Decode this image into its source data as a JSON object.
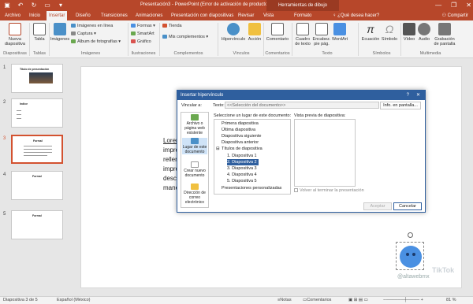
{
  "window": {
    "title": "Presentación3 - PowerPoint (Error de activación de productos)",
    "context_tab": "Herramientas de dibujo",
    "controls": [
      "—",
      "❐",
      "✕"
    ]
  },
  "tabs": [
    {
      "label": "Archivo"
    },
    {
      "label": "Inicio"
    },
    {
      "label": "Insertar"
    },
    {
      "label": "Diseño"
    },
    {
      "label": "Transiciones"
    },
    {
      "label": "Animaciones"
    },
    {
      "label": "Presentación con diapositivas"
    },
    {
      "label": "Revisar"
    },
    {
      "label": "Vista"
    },
    {
      "label": "Formato"
    }
  ],
  "tell_me": "¿Qué desea hacer?",
  "share": "Compartir",
  "ribbon": {
    "nueva": "Nueva diapositiva",
    "tabla": "Tabla",
    "imagenes": "Imágenes",
    "imagenes_linea": "Imágenes en línea",
    "captura": "Captura",
    "album": "Álbum de fotografías",
    "formas": "Formas",
    "smartart": "SmartArt",
    "grafico": "Gráfico",
    "tienda": "Tienda",
    "complementos": "Mis complementos",
    "hipervinculo": "Hipervínculo",
    "accion": "Acción",
    "comentario": "Comentario",
    "cuadro": "Cuadro de texto",
    "encab": "Encabez. pie pág.",
    "wordart": "WordArt",
    "ecuacion": "Ecuación",
    "simbolo": "Símbolo",
    "video": "Vídeo",
    "audio": "Audio",
    "grabacion": "Grabación de pantalla",
    "groups": {
      "diapositivas": "Diapositivas",
      "tablas": "Tablas",
      "imagenes": "Imágenes",
      "ilustraciones": "Ilustraciones",
      "complementos": "Complementos",
      "vinculos": "Vínculos",
      "comentarios": "Comentarios",
      "texto": "Texto",
      "simbolos": "Símbolos",
      "multimedia": "Multimedia"
    }
  },
  "thumbnails": [
    {
      "num": "1",
      "title": "Titulo de presentación"
    },
    {
      "num": "2",
      "title": "Indice"
    },
    {
      "num": "3",
      "title": "Formal"
    },
    {
      "num": "4",
      "title": "Formal"
    },
    {
      "num": "5",
      "title": "Formal"
    }
  ],
  "slide_text": [
    "Lorem",
    "impre",
    "relleno",
    "impre",
    "desco",
    "mane"
  ],
  "dialog": {
    "title": "Insertar hipervínculo",
    "help": "?",
    "close": "✕",
    "vincular_label": "Vincular a:",
    "texto_label": "Texto:",
    "texto_value": "<<Selección del documento>>",
    "info_button": "Info. en pantalla...",
    "link_types": [
      "Archivo o página web existente",
      "Lugar de este documento",
      "Crear nuevo documento",
      "Dirección de correo electrónico"
    ],
    "select_label": "Seleccione un lugar de este documento:",
    "tree": [
      "Primera diapositiva",
      "Última diapositiva",
      "Diapositiva siguiente",
      "Diapositiva anterior",
      "Títulos de diapositiva",
      "1. Diapositiva 1",
      "2. Diapositiva 2",
      "3. Diapositiva 3",
      "4. Diapositiva 4",
      "5. Diapositiva 5",
      "Presentaciones personalizadas"
    ],
    "tree_toggle": "⊟",
    "preview_label": "Vista previa de diapositiva:",
    "show_return": "Volver al terminar la presentación",
    "ok": "Aceptar",
    "cancel": "Cancelar"
  },
  "status": {
    "slide": "Diapositiva 3 de 5",
    "language": "Español (México)",
    "notes": "Notas",
    "comments": "Comentarios",
    "zoom": "81 %"
  },
  "watermark": "@altawebmx",
  "watermark_logo": "TikTok"
}
